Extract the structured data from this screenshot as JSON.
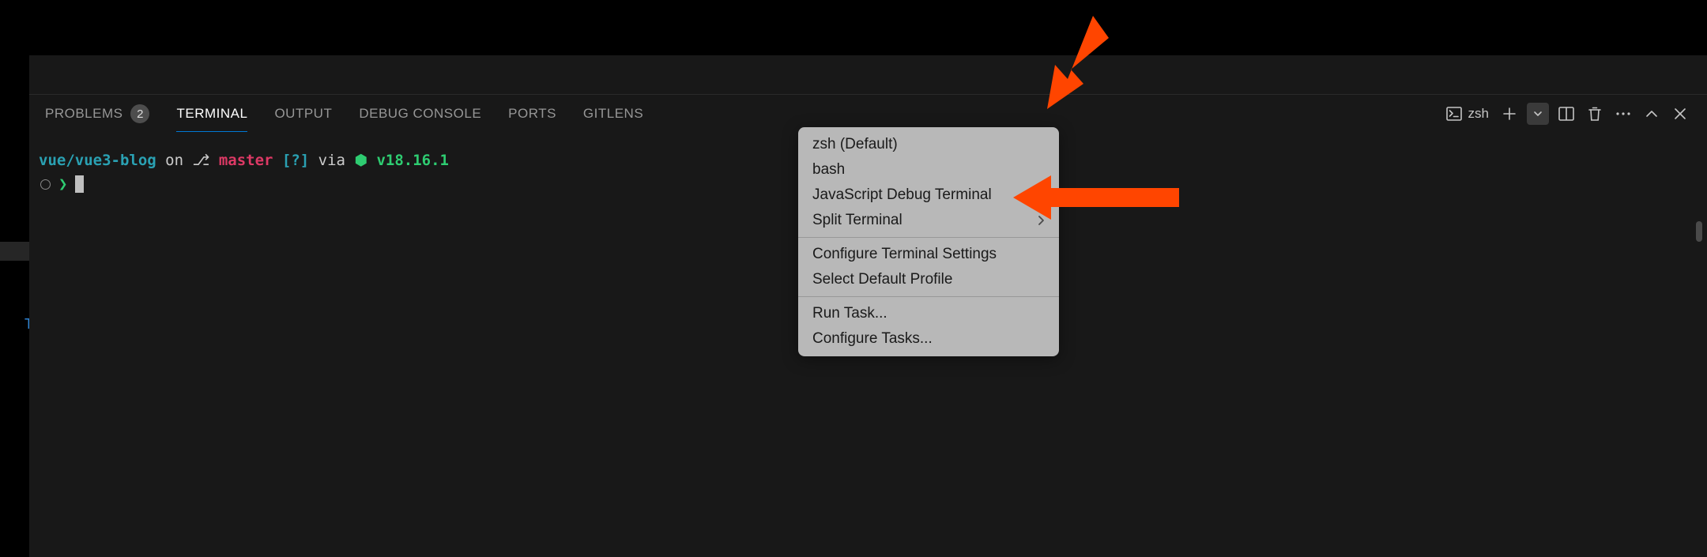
{
  "tabs": {
    "problems": {
      "label": "PROBLEMS",
      "badge": "2"
    },
    "terminal": {
      "label": "TERMINAL"
    },
    "output": {
      "label": "OUTPUT"
    },
    "debugConsole": {
      "label": "DEBUG CONSOLE"
    },
    "ports": {
      "label": "PORTS"
    },
    "gitlens": {
      "label": "GITLENS"
    }
  },
  "toolbar": {
    "shell": "zsh"
  },
  "prompt": {
    "cwd": "vue/vue3-blog",
    "on": " on ",
    "gitIcon": "⎇",
    "branch": " master ",
    "status": "[?]",
    "via": " via ",
    "nodeIcon": "⬢",
    "nodeVer": " v18.16.1",
    "arrow": "❯"
  },
  "menu": {
    "zshDefault": "zsh (Default)",
    "bash": "bash",
    "jsDebug": "JavaScript Debug Terminal",
    "split": "Split Terminal",
    "configureSettings": "Configure Terminal Settings",
    "selectProfile": "Select Default Profile",
    "runTask": "Run Task...",
    "configureTasks": "Configure Tasks..."
  }
}
